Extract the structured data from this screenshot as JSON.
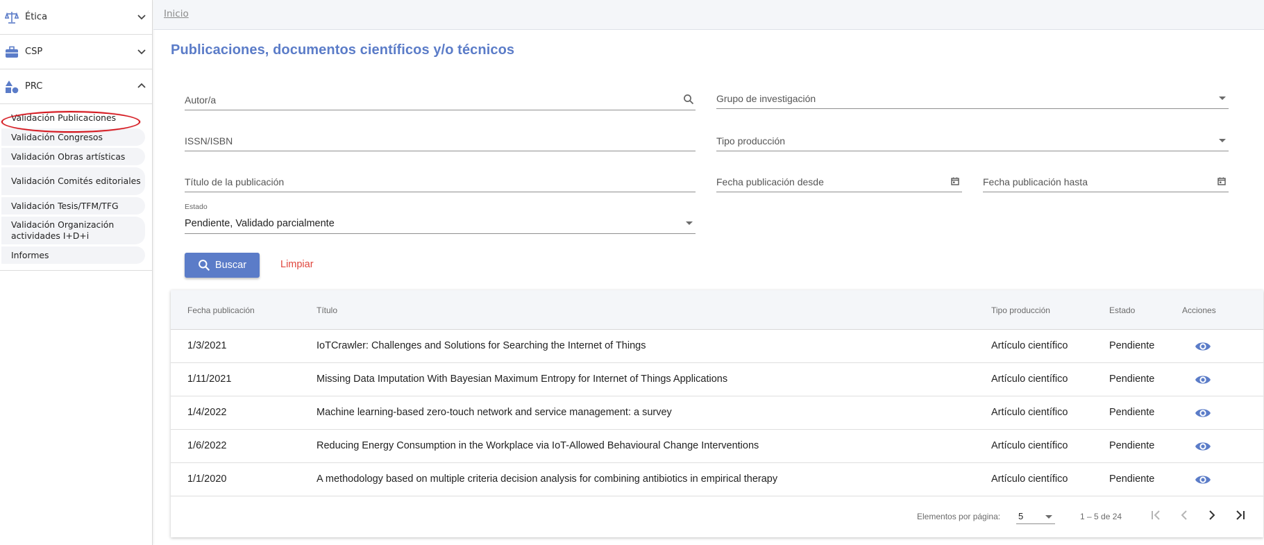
{
  "sidebar": {
    "modules": [
      {
        "label": "Ética",
        "icon": "scale-icon",
        "expanded": false
      },
      {
        "label": "CSP",
        "icon": "briefcase-icon",
        "expanded": false
      },
      {
        "label": "PRC",
        "icon": "shapes-icon",
        "expanded": true
      }
    ],
    "prc_items": [
      {
        "label": "Validación Publicaciones",
        "active": true
      },
      {
        "label": "Validación Congresos"
      },
      {
        "label": "Validación Obras artísticas"
      },
      {
        "label": "Validación Comités editoriales"
      },
      {
        "label": "Validación Tesis/TFM/TFG"
      },
      {
        "label": "Validación Organización actividades I+D+i"
      },
      {
        "label": "Informes"
      }
    ]
  },
  "breadcrumb": {
    "home": "Inicio"
  },
  "page": {
    "title": "Publicaciones, documentos científicos y/o técnicos"
  },
  "filters": {
    "autor": {
      "label": "Autor/a",
      "icon": "search-icon"
    },
    "grupo": {
      "label": "Grupo de investigación"
    },
    "issn": {
      "label": "ISSN/ISBN"
    },
    "tipo": {
      "label": "Tipo producción"
    },
    "titulo": {
      "label": "Título de la publicación"
    },
    "fecha_desde": {
      "label": "Fecha publicación desde",
      "icon": "calendar-icon"
    },
    "fecha_hasta": {
      "label": "Fecha publicación hasta",
      "icon": "calendar-icon"
    },
    "estado": {
      "label": "Estado",
      "value": "Pendiente, Validado parcialmente"
    }
  },
  "actions": {
    "search": "Buscar",
    "clear": "Limpiar"
  },
  "table": {
    "headers": {
      "fecha": "Fecha publicación",
      "titulo": "Título",
      "tipo": "Tipo producción",
      "estado": "Estado",
      "acciones": "Acciones"
    },
    "rows": [
      {
        "fecha": "1/3/2021",
        "titulo": "IoTCrawler: Challenges and Solutions for Searching the Internet of Things",
        "tipo": "Artículo científico",
        "estado": "Pendiente"
      },
      {
        "fecha": "1/11/2021",
        "titulo": "Missing Data Imputation With Bayesian Maximum Entropy for Internet of Things Applications",
        "tipo": "Artículo científico",
        "estado": "Pendiente"
      },
      {
        "fecha": "1/4/2022",
        "titulo": "Machine learning-based zero-touch network and service management: a survey",
        "tipo": "Artículo científico",
        "estado": "Pendiente"
      },
      {
        "fecha": "1/6/2022",
        "titulo": "Reducing Energy Consumption in the Workplace via IoT-Allowed Behavioural Change Interventions",
        "tipo": "Artículo científico",
        "estado": "Pendiente"
      },
      {
        "fecha": "1/1/2020",
        "titulo": "A methodology based on multiple criteria decision analysis for combining antibiotics in empirical therapy",
        "tipo": "Artículo científico",
        "estado": "Pendiente"
      }
    ]
  },
  "paginator": {
    "items_label": "Elementos por página:",
    "page_size": "5",
    "range": "1 – 5 de 24"
  },
  "colors": {
    "accent": "#5b7cc8",
    "clear": "#e0463d",
    "highlight": "#d4141b"
  }
}
